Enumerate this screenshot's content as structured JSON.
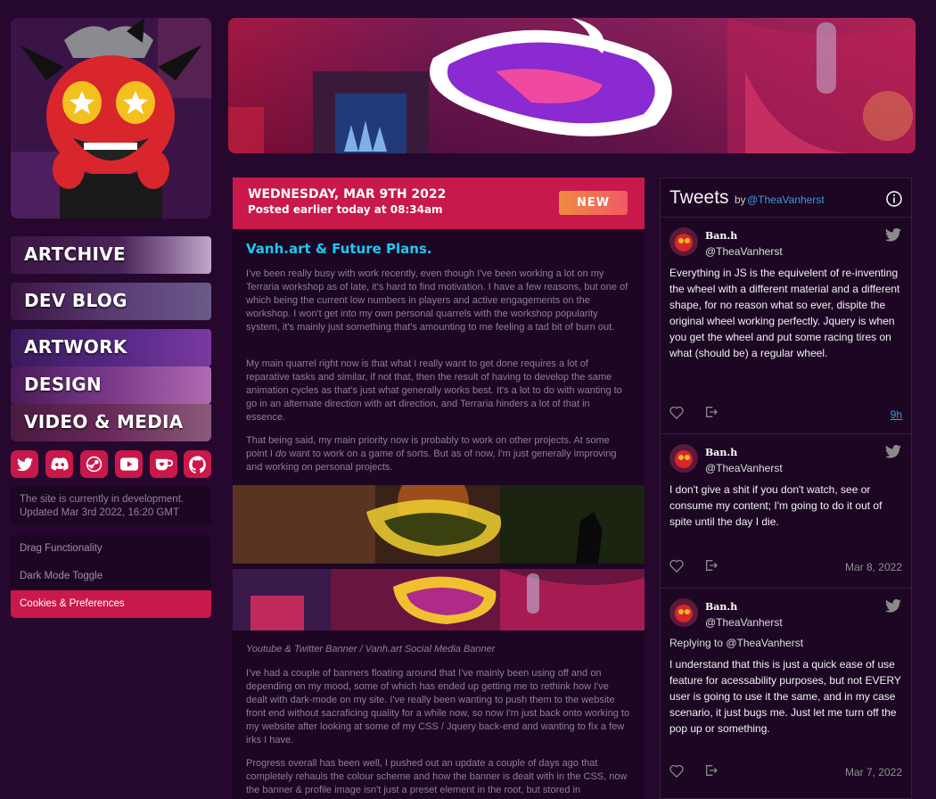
{
  "sidebar": {
    "nav": [
      {
        "label": "ARTCHIVE"
      },
      {
        "label": "DEV BLOG"
      },
      {
        "label": "ARTWORK"
      },
      {
        "label": "DESIGN"
      },
      {
        "label": "VIDEO & MEDIA"
      }
    ],
    "social_icons": [
      "twitter-icon",
      "discord-icon",
      "steam-icon",
      "youtube-icon",
      "kofi-icon",
      "github-icon"
    ],
    "dev_note": {
      "line1": "The site is currently in development.",
      "line2": "Updated Mar 3rd 2022, 16:20 GMT"
    },
    "options": [
      {
        "label": "Drag Functionality"
      },
      {
        "label": "Dark Mode Toggle"
      },
      {
        "label": "Cookies & Preferences"
      }
    ]
  },
  "post": {
    "date": "WEDNESDAY, MAR 9TH 2022",
    "posted": "Posted earlier today at 08:34am",
    "badge": "NEW",
    "title": "Vanh.art & Future Plans.",
    "paragraphs": [
      "I've been really busy with work recently, even though I've been working a lot on my Terraria workshop as of late, it's hard to find motivation. I have a few reasons, but one of which being the current low numbers in players and active engagements on the workshop. I won't get into my own personal quarrels with the workshop popularity system, it's mainly just something that's amounting to me feeling a tad bit of burn out.",
      "My main quarrel right now is that what I really want to get done requires a lot of reparative tasks and similar, if not that, then the result of having to develop the same animation cycles as that's just what generally works best. It's a lot to do with wanting to go in an alternate direction with art direction, and Terraria hinders a lot of that in essence.",
      "That being said, my main priority now is probably to work on other projects. At some point I",
      "do",
      "want to work on a game of sorts. But as of now, I'm just generally improving and working on personal projects.",
      "I've had a couple of banners floating around that I've mainly been using off and on depending on my mood, some of which has ended up getting me to rethink how I've dealt with dark-mode on my site. I've really been wanting to push them to the website front end without sacraficing quality for a while now, so now I'm just back onto working to my website after looking at some of my CSS / Jquery back-end and wanting to fix a few irks I have.",
      "Progress overall has been well, I pushed out an update a couple of days ago that completely rehauls the colour scheme and how the banner is dealt with in the CSS, now the banner & profile image isn't just a preset element in the root, but stored in"
    ],
    "caption": "Youtube & Twitter Banner / Vanh.art Social Media Banner"
  },
  "tweets": {
    "title": "Tweets",
    "by": "by",
    "handle": "@TheaVanherst",
    "items": [
      {
        "name": "Ban.h",
        "handle": "@TheaVanherst",
        "reply": "",
        "text": "Everything in JS is the equivelent of re-inventing the wheel with a different material and a different shape, for no reason what so ever, dispite the original wheel working perfectly. Jquery is when you get the wheel and put some racing tires on what (should be) a regular wheel.",
        "time": "9h"
      },
      {
        "name": "Ban.h",
        "handle": "@TheaVanherst",
        "reply": "",
        "text": "I don't give a shit if you don't watch, see or consume my content; I'm going to do it out of spite until the day I die.",
        "time": "Mar 8, 2022"
      },
      {
        "name": "Ban.h",
        "handle": "@TheaVanherst",
        "reply": "Replying to @TheaVanherst",
        "text": "I understand that this is just a quick ease of use feature for acessability purposes, but not EVERY user is going to use it the same, and in my case scenario, it just bugs me. Just let me turn off the pop up or something.",
        "time": "Mar 7, 2022"
      }
    ]
  },
  "colors": {
    "background": "#26082e",
    "panel": "#1c0624",
    "accent": "#c9184a",
    "title": "#1ec8f0",
    "link": "#3f9ad8"
  }
}
